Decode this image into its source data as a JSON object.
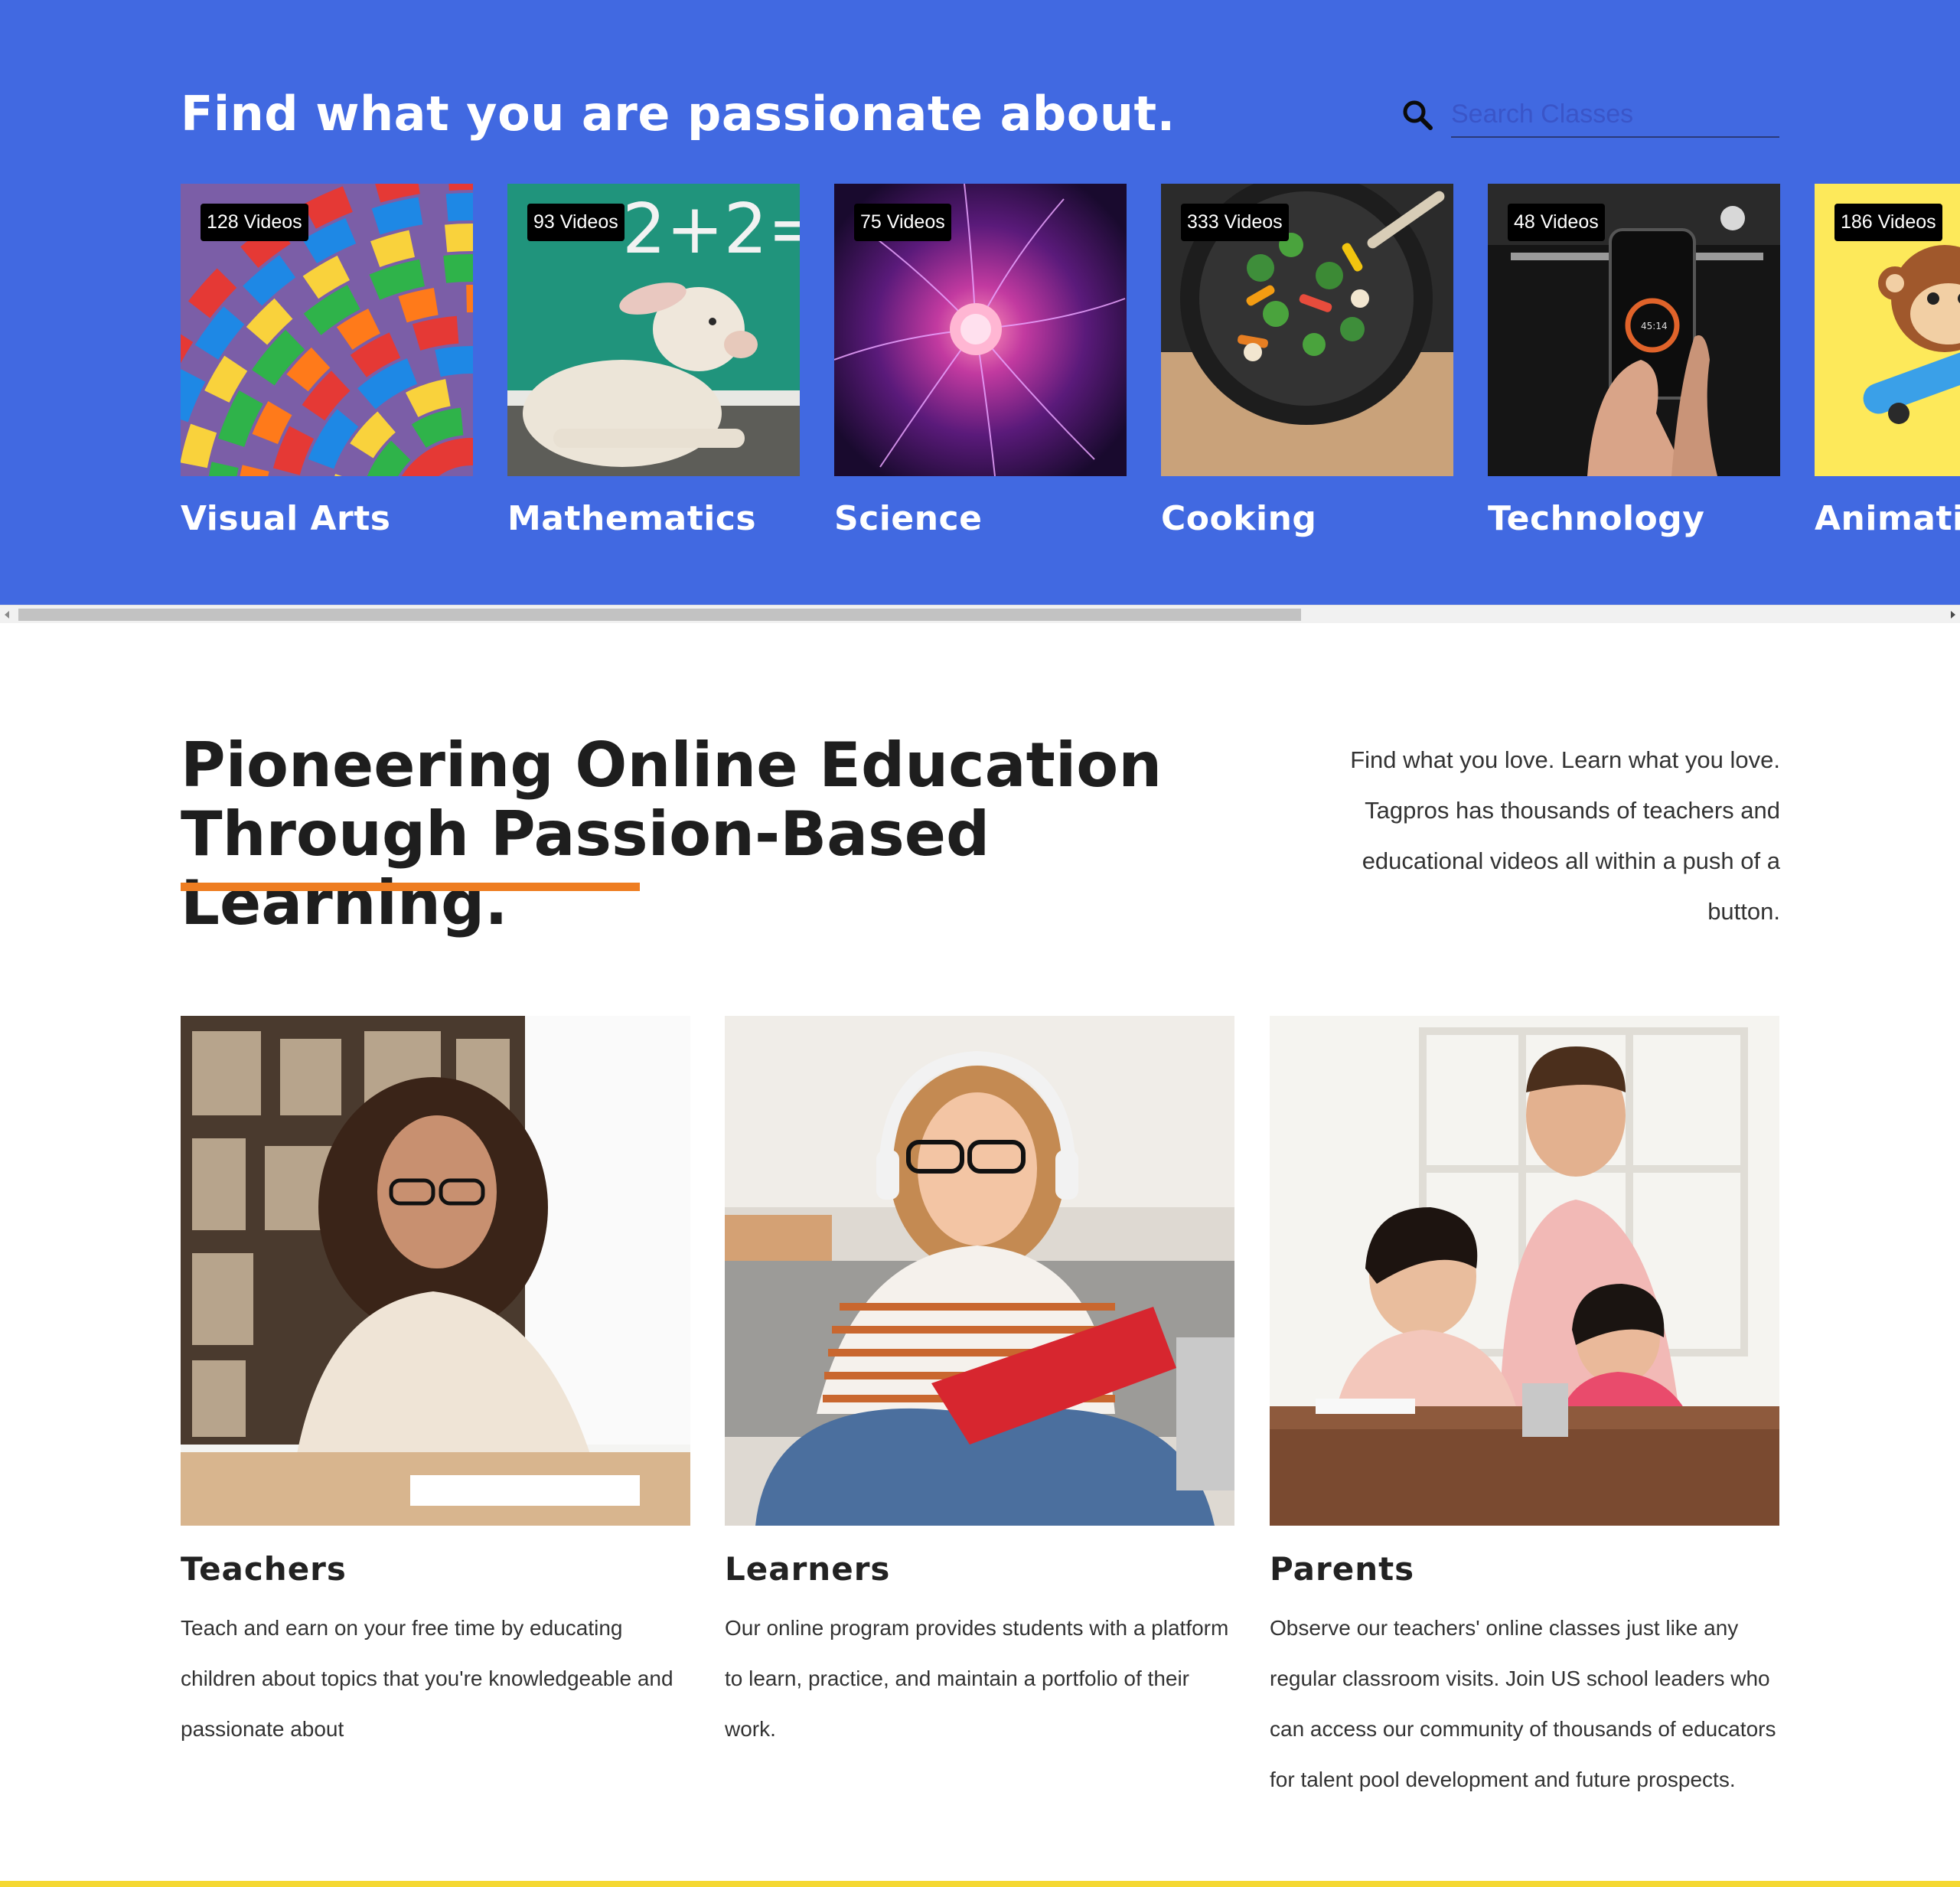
{
  "hero": {
    "title": "Find what you are passionate about.",
    "search_placeholder": "Search Classes",
    "background": "#4169e1",
    "categories": [
      {
        "label": "Visual Arts",
        "badge": "128 Videos"
      },
      {
        "label": "Mathematics",
        "badge": "93 Videos"
      },
      {
        "label": "Science",
        "badge": "75 Videos"
      },
      {
        "label": "Cooking",
        "badge": "333 Videos"
      },
      {
        "label": "Technology",
        "badge": "48 Videos"
      },
      {
        "label": "Animation",
        "badge": "186 Videos"
      }
    ]
  },
  "intro": {
    "headline_line1": "Pioneering Online Education",
    "headline_line2": "Through Passion-Based Learning.",
    "accent_color": "#ee7d21",
    "text": "Find what you love. Learn what you love. Tagpros has thousands of teachers and educational videos all within a push of a button."
  },
  "audiences": [
    {
      "title": "Teachers",
      "text": "Teach and earn on your free time by educating children about topics that you're knowledgeable and passionate about"
    },
    {
      "title": "Learners",
      "text": "Our online program provides students with a platform to learn, practice, and maintain a portfolio of their work."
    },
    {
      "title": "Parents",
      "text": "Observe our teachers' online classes just like any regular classroom visits. Join US school leaders who can access our community of thousands of educators for talent pool development and future prospects."
    }
  ]
}
